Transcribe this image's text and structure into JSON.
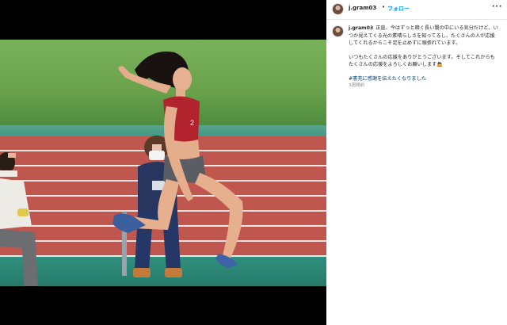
{
  "post": {
    "username": "j.gram03",
    "separator": "•",
    "follow_label": "フォロー",
    "more_label": "···"
  },
  "caption": {
    "username": "j.gram03",
    "paragraph_1": "正直、今はずっと暗く長い闇の中にいる気分だけど、いつか見えてくる光の素晴らしさを知ってるし、たくさんの人が応援してくれるからこそ足を止めずに頑張れています。",
    "paragraph_2": "いつもたくさんの応援をありがとうございます。そしてこれからもたくさんの応援をよろしくお願いします🙇",
    "hashtag": "#憲充に感謝を伝えたくなりました",
    "timestamp": "3週間前"
  },
  "icons": {
    "avatar": "profile-avatar",
    "more": "more-options-icon"
  },
  "colors": {
    "link_blue": "#0095f6",
    "hashtag": "#00376b",
    "text": "#262626",
    "muted": "#8e8e8e"
  }
}
